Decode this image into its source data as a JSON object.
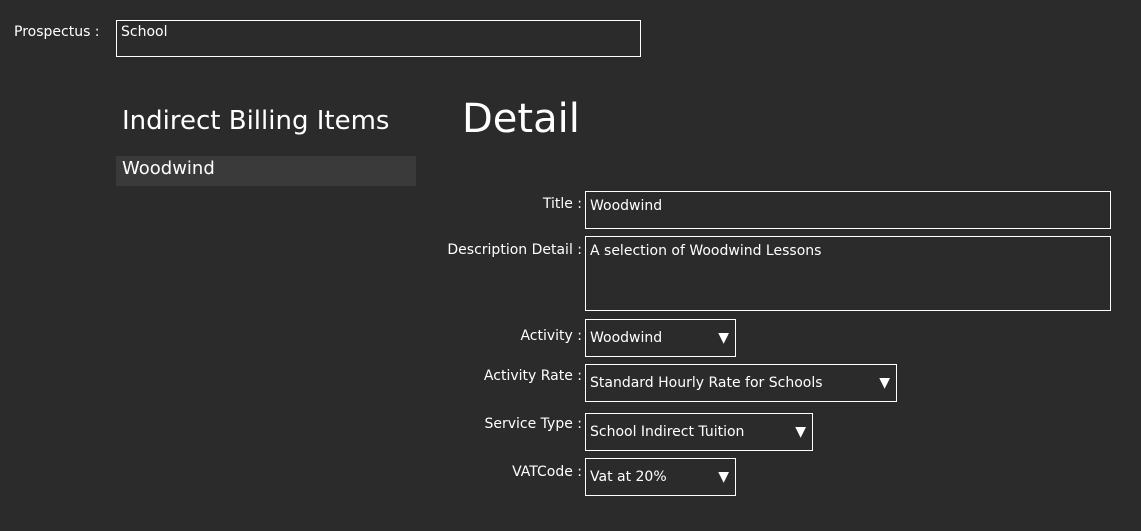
{
  "prospectus": {
    "label": "Prospectus :",
    "value": "School"
  },
  "list": {
    "heading": "Indirect Billing Items",
    "items": [
      {
        "label": "Woodwind"
      }
    ]
  },
  "detail": {
    "heading": "Detail",
    "title": {
      "label": "Title :",
      "value": "Woodwind"
    },
    "description": {
      "label": "Description Detail :",
      "value": "A selection of Woodwind Lessons"
    },
    "activity": {
      "label": "Activity :",
      "value": "Woodwind",
      "icon": "caret-down-icon"
    },
    "activity_rate": {
      "label": "Activity Rate :",
      "value": "Standard Hourly Rate for Schools",
      "icon": "caret-down-icon"
    },
    "service_type": {
      "label": "Service Type :",
      "value": "School Indirect Tuition",
      "icon": "caret-down-icon"
    },
    "vat_code": {
      "label": "VATCode :",
      "value": "Vat at 20%",
      "icon": "caret-down-icon"
    }
  },
  "colors": {
    "background": "#2b2b2b",
    "list_item_background": "#3a3a3a",
    "border": "#ffffff",
    "text": "#ffffff"
  }
}
